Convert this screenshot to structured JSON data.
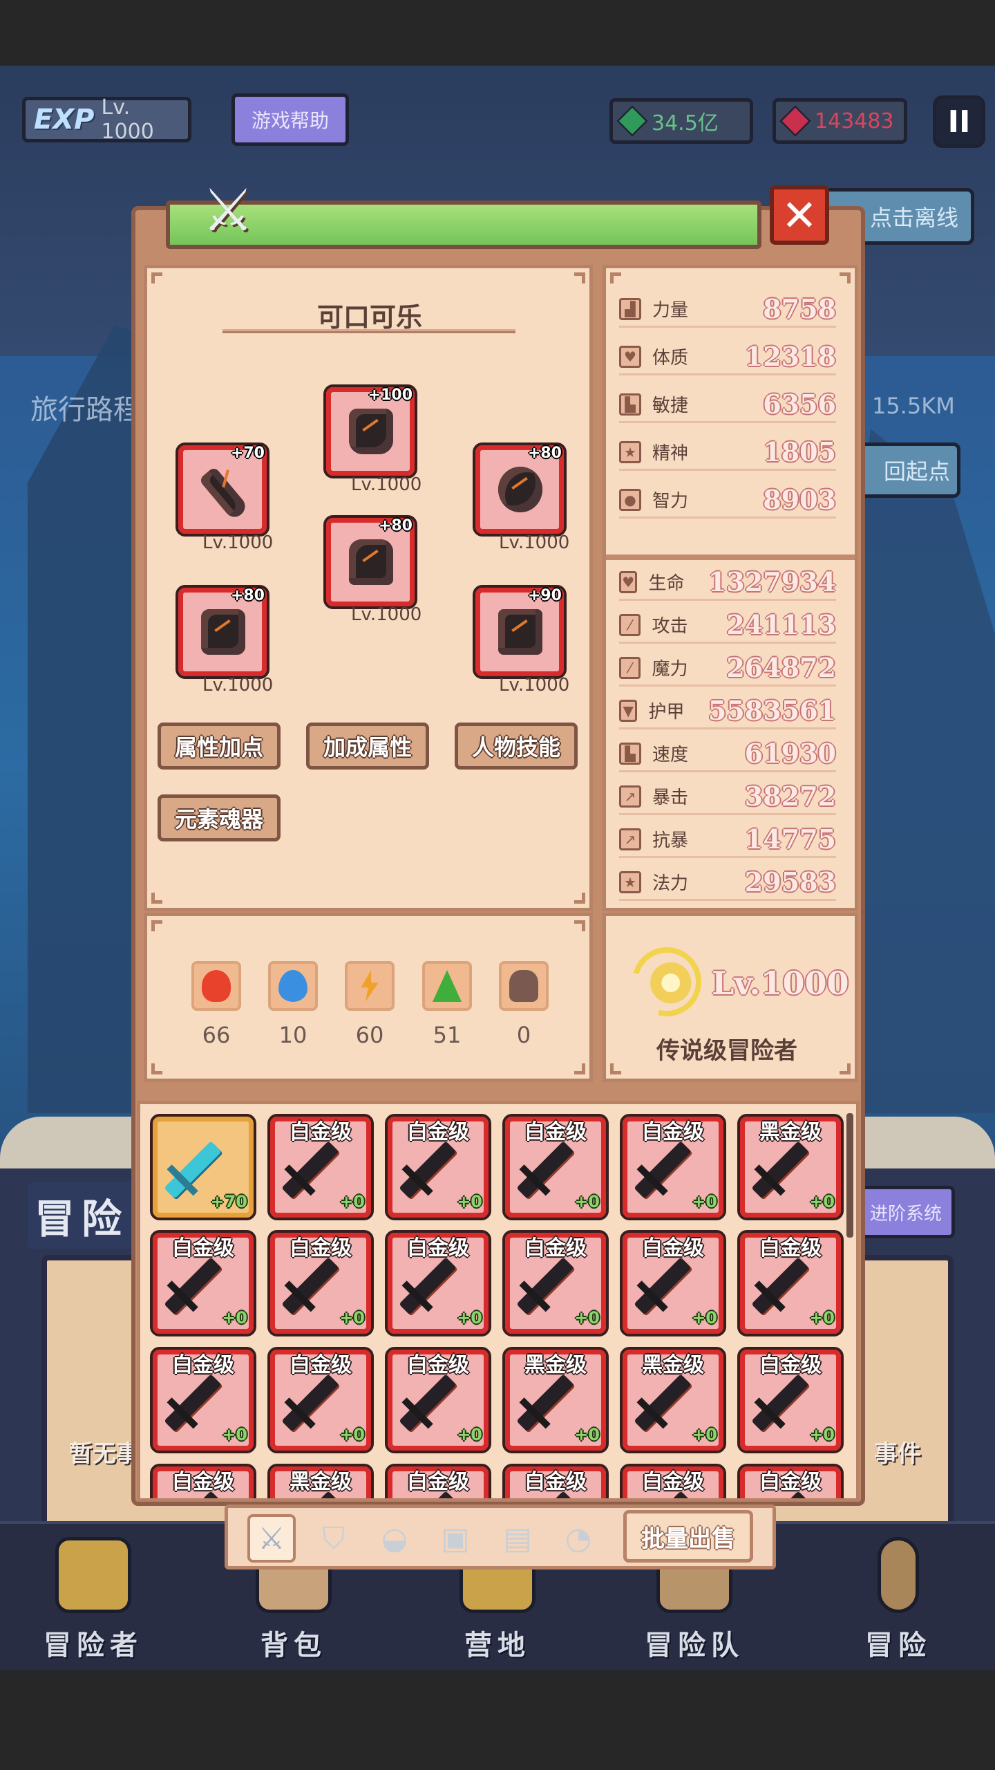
{
  "hud": {
    "exp_label": "EXP",
    "player_level": "Lv. 1000",
    "help_label": "游戏帮助",
    "green_gems": "34.5亿",
    "red_gems": "143483",
    "pause_label": "II",
    "offline_label": "点击离线",
    "route_label": "旅行路程",
    "route_distance": "15.5KM",
    "return_label": "回起点",
    "adventure_title": "冒险",
    "advance_label": "进阶系统",
    "no_event_label": "暂无事",
    "event_label": "事件"
  },
  "panel": {
    "close_label": "✕",
    "character_name": "可口可乐",
    "equipment": [
      {
        "slot": "helmet",
        "plus": "+100",
        "level": "Lv.1000"
      },
      {
        "slot": "weapon",
        "plus": "+70",
        "level": "Lv.1000"
      },
      {
        "slot": "shield",
        "plus": "+80",
        "level": "Lv.1000"
      },
      {
        "slot": "armor",
        "plus": "+80",
        "level": "Lv.1000"
      },
      {
        "slot": "gloves",
        "plus": "+80",
        "level": "Lv.1000"
      },
      {
        "slot": "boots",
        "plus": "+90",
        "level": "Lv.1000"
      }
    ],
    "buttons": {
      "attr_points": "属性加点",
      "bonus_attrs": "加成属性",
      "char_skills": "人物技能",
      "element_soul": "元素魂器"
    },
    "base_stats": [
      {
        "label": "力量",
        "value": "8758",
        "icon": "power-icon"
      },
      {
        "label": "体质",
        "value": "12318",
        "icon": "heart-icon"
      },
      {
        "label": "敏捷",
        "value": "6356",
        "icon": "boot-icon"
      },
      {
        "label": "精神",
        "value": "1805",
        "icon": "star-icon"
      },
      {
        "label": "智力",
        "value": "8903",
        "icon": "brain-icon"
      }
    ],
    "combat_stats": [
      {
        "label": "生命",
        "value": "1327934",
        "icon": "heart-icon"
      },
      {
        "label": "攻击",
        "value": "241113",
        "icon": "sword-icon"
      },
      {
        "label": "魔力",
        "value": "264872",
        "icon": "wand-icon"
      },
      {
        "label": "护甲",
        "value": "5583561",
        "icon": "shield-icon"
      },
      {
        "label": "速度",
        "value": "61930",
        "icon": "boot-icon"
      },
      {
        "label": "暴击",
        "value": "38272",
        "icon": "crit-icon"
      },
      {
        "label": "抗暴",
        "value": "14775",
        "icon": "crit-icon"
      },
      {
        "label": "法力",
        "value": "29583",
        "icon": "star-icon"
      }
    ],
    "elements": [
      {
        "name": "fire",
        "count": "66",
        "color": "#e8412c"
      },
      {
        "name": "water",
        "count": "10",
        "color": "#3a8fe0"
      },
      {
        "name": "lightning",
        "count": "60",
        "color": "#f0a12a"
      },
      {
        "name": "nature",
        "count": "51",
        "color": "#3fae3a"
      },
      {
        "name": "dark",
        "count": "0",
        "color": "#7a5a50"
      }
    ],
    "rank": {
      "level": "Lv.1000",
      "title": "传说级冒险者"
    }
  },
  "inventory": {
    "items": [
      {
        "grade": "",
        "plus": "+70",
        "selected": true
      },
      {
        "grade": "白金级",
        "plus": "+0"
      },
      {
        "grade": "白金级",
        "plus": "+0"
      },
      {
        "grade": "白金级",
        "plus": "+0"
      },
      {
        "grade": "白金级",
        "plus": "+0"
      },
      {
        "grade": "黑金级",
        "plus": "+0"
      },
      {
        "grade": "白金级",
        "plus": "+0"
      },
      {
        "grade": "白金级",
        "plus": "+0"
      },
      {
        "grade": "白金级",
        "plus": "+0"
      },
      {
        "grade": "白金级",
        "plus": "+0"
      },
      {
        "grade": "白金级",
        "plus": "+0"
      },
      {
        "grade": "白金级",
        "plus": "+0"
      },
      {
        "grade": "白金级",
        "plus": "+0"
      },
      {
        "grade": "白金级",
        "plus": "+0"
      },
      {
        "grade": "白金级",
        "plus": "+0"
      },
      {
        "grade": "黑金级",
        "plus": "+0"
      },
      {
        "grade": "黑金级",
        "plus": "+0"
      },
      {
        "grade": "白金级",
        "plus": "+0"
      },
      {
        "grade": "白金级",
        "plus": ""
      },
      {
        "grade": "黑金级",
        "plus": ""
      },
      {
        "grade": "白金级",
        "plus": ""
      },
      {
        "grade": "白金级",
        "plus": ""
      },
      {
        "grade": "白金级",
        "plus": ""
      },
      {
        "grade": "白金级",
        "plus": ""
      }
    ],
    "tabs": [
      "sword-icon",
      "shield-icon",
      "helmet-icon",
      "armor-icon",
      "gloves-icon",
      "boots-icon"
    ],
    "bulk_sell_label": "批量出售"
  },
  "nav": [
    {
      "label": "冒险者",
      "icon": "helmet-icon"
    },
    {
      "label": "背包",
      "icon": "backpack-icon"
    },
    {
      "label": "营地",
      "icon": "camp-icon"
    },
    {
      "label": "冒险队",
      "icon": "team-icon"
    },
    {
      "label": "冒险",
      "icon": "sword-icon"
    }
  ]
}
